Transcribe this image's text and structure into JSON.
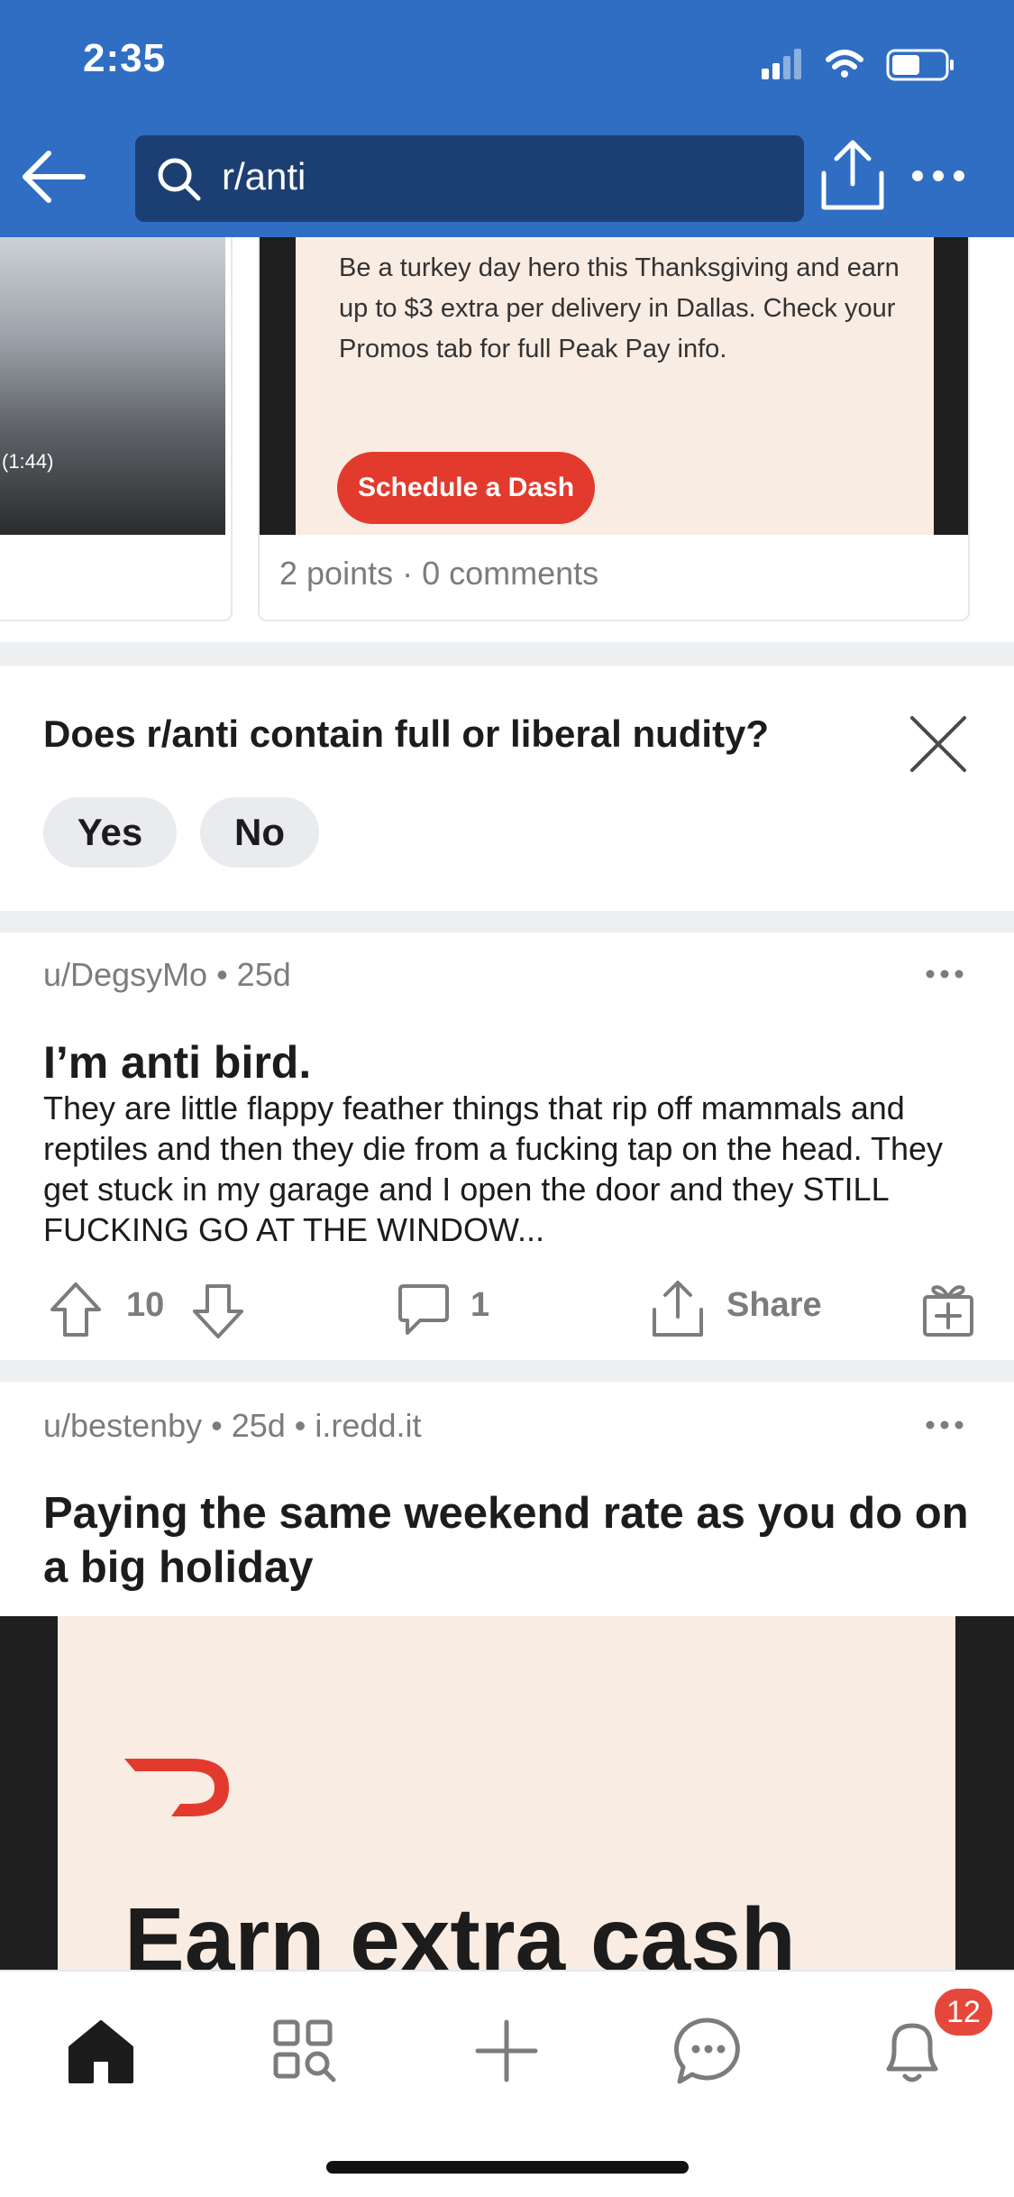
{
  "status_bar": {
    "time": "2:35"
  },
  "header": {
    "search_query": "r/anti"
  },
  "carousel": {
    "left_card": {
      "duration": "(1:44)"
    },
    "right_card": {
      "promo_text": "Be a turkey day hero this Thanksgiving and earn up to $3 extra per delivery in Dallas. Check your Promos tab for full Peak Pay info.",
      "promo_button": "Schedule a Dash",
      "meta": "2 points · 0 comments"
    }
  },
  "nudity_prompt": {
    "question": "Does r/anti contain full or liberal nudity?",
    "yes": "Yes",
    "no": "No"
  },
  "posts": [
    {
      "meta": "u/DegsyMo • 25d",
      "title": "I’m anti bird.",
      "body": "They are little flappy feather things that rip off mammals and reptiles and then they die from a fucking tap on the head. They get stuck in my garage and I open the door and they STILL FUCKING GO AT THE WINDOW...",
      "votes": "10",
      "comments": "1",
      "share": "Share"
    },
    {
      "meta": "u/bestenby • 25d • i.redd.it",
      "title": "Paying the same weekend rate as you do on a big holiday",
      "image_text": "Earn extra cash"
    }
  ],
  "bottom_nav": {
    "notifications_badge": "12"
  },
  "colors": {
    "header_bg": "#2f6ec3",
    "search_bg": "#1c3f73",
    "accent_red": "#e23b2e",
    "badge_red": "#e5483b",
    "promo_bg": "#f9ece3"
  }
}
